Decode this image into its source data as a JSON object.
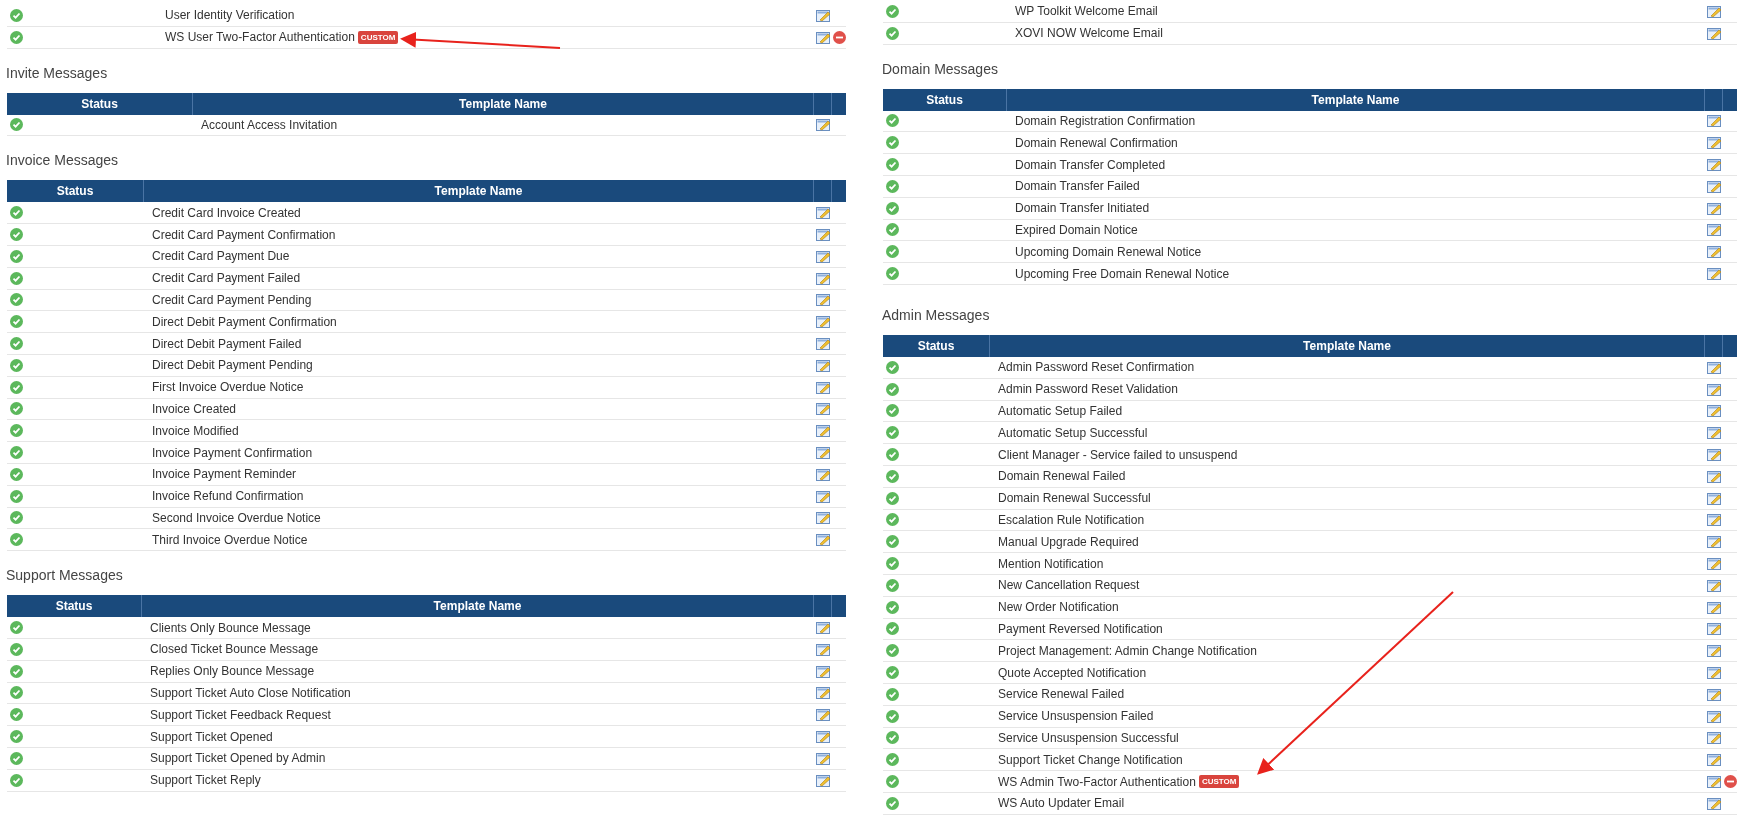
{
  "columns": [
    {
      "sections": [
        {
          "rows": [
            {
              "status": true,
              "name": "User Identity Verification",
              "edit": true,
              "delete": false
            },
            {
              "status": true,
              "name": "WS User Two-Factor Authentication",
              "badge": "CUSTOM",
              "edit": true,
              "delete": true
            }
          ]
        },
        {
          "title": "Invite Messages",
          "headers": [
            "Status",
            "Template Name"
          ],
          "rows": [
            {
              "status": true,
              "name": "Account Access Invitation",
              "edit": true,
              "delete": false
            }
          ]
        },
        {
          "title": "Invoice Messages",
          "headers": [
            "Status",
            "Template Name"
          ],
          "rows": [
            {
              "status": true,
              "name": "Credit Card Invoice Created",
              "edit": true,
              "delete": false
            },
            {
              "status": true,
              "name": "Credit Card Payment Confirmation",
              "edit": true,
              "delete": false
            },
            {
              "status": true,
              "name": "Credit Card Payment Due",
              "edit": true,
              "delete": false
            },
            {
              "status": true,
              "name": "Credit Card Payment Failed",
              "edit": true,
              "delete": false
            },
            {
              "status": true,
              "name": "Credit Card Payment Pending",
              "edit": true,
              "delete": false
            },
            {
              "status": true,
              "name": "Direct Debit Payment Confirmation",
              "edit": true,
              "delete": false
            },
            {
              "status": true,
              "name": "Direct Debit Payment Failed",
              "edit": true,
              "delete": false
            },
            {
              "status": true,
              "name": "Direct Debit Payment Pending",
              "edit": true,
              "delete": false
            },
            {
              "status": true,
              "name": "First Invoice Overdue Notice",
              "edit": true,
              "delete": false
            },
            {
              "status": true,
              "name": "Invoice Created",
              "edit": true,
              "delete": false
            },
            {
              "status": true,
              "name": "Invoice Modified",
              "edit": true,
              "delete": false
            },
            {
              "status": true,
              "name": "Invoice Payment Confirmation",
              "edit": true,
              "delete": false
            },
            {
              "status": true,
              "name": "Invoice Payment Reminder",
              "edit": true,
              "delete": false
            },
            {
              "status": true,
              "name": "Invoice Refund Confirmation",
              "edit": true,
              "delete": false
            },
            {
              "status": true,
              "name": "Second Invoice Overdue Notice",
              "edit": true,
              "delete": false
            },
            {
              "status": true,
              "name": "Third Invoice Overdue Notice",
              "edit": true,
              "delete": false
            }
          ]
        },
        {
          "title": "Support Messages",
          "headers": [
            "Status",
            "Template Name"
          ],
          "rows": [
            {
              "status": true,
              "name": "Clients Only Bounce Message",
              "edit": true,
              "delete": false
            },
            {
              "status": true,
              "name": "Closed Ticket Bounce Message",
              "edit": true,
              "delete": false
            },
            {
              "status": true,
              "name": "Replies Only Bounce Message",
              "edit": true,
              "delete": false
            },
            {
              "status": true,
              "name": "Support Ticket Auto Close Notification",
              "edit": true,
              "delete": false
            },
            {
              "status": true,
              "name": "Support Ticket Feedback Request",
              "edit": true,
              "delete": false
            },
            {
              "status": true,
              "name": "Support Ticket Opened",
              "edit": true,
              "delete": false
            },
            {
              "status": true,
              "name": "Support Ticket Opened by Admin",
              "edit": true,
              "delete": false
            },
            {
              "status": true,
              "name": "Support Ticket Reply",
              "edit": true,
              "delete": false
            }
          ]
        }
      ]
    },
    {
      "sections": [
        {
          "rows": [
            {
              "status": true,
              "name": "WP Toolkit Welcome Email",
              "edit": true,
              "delete": false
            },
            {
              "status": true,
              "name": "XOVI NOW Welcome Email",
              "edit": true,
              "delete": false
            }
          ]
        },
        {
          "title": "Domain Messages",
          "headers": [
            "Status",
            "Template Name"
          ],
          "rows": [
            {
              "status": true,
              "name": "Domain Registration Confirmation",
              "edit": true,
              "delete": false
            },
            {
              "status": true,
              "name": "Domain Renewal Confirmation",
              "edit": true,
              "delete": false
            },
            {
              "status": true,
              "name": "Domain Transfer Completed",
              "edit": true,
              "delete": false
            },
            {
              "status": true,
              "name": "Domain Transfer Failed",
              "edit": true,
              "delete": false
            },
            {
              "status": true,
              "name": "Domain Transfer Initiated",
              "edit": true,
              "delete": false
            },
            {
              "status": true,
              "name": "Expired Domain Notice",
              "edit": true,
              "delete": false
            },
            {
              "status": true,
              "name": "Upcoming Domain Renewal Notice",
              "edit": true,
              "delete": false
            },
            {
              "status": true,
              "name": "Upcoming Free Domain Renewal Notice",
              "edit": true,
              "delete": false
            }
          ]
        },
        {
          "title": "Admin Messages",
          "headers": [
            "Status",
            "Template Name"
          ],
          "rows": [
            {
              "status": true,
              "name": "Admin Password Reset Confirmation",
              "edit": true,
              "delete": false
            },
            {
              "status": true,
              "name": "Admin Password Reset Validation",
              "edit": true,
              "delete": false
            },
            {
              "status": true,
              "name": "Automatic Setup Failed",
              "edit": true,
              "delete": false
            },
            {
              "status": true,
              "name": "Automatic Setup Successful",
              "edit": true,
              "delete": false
            },
            {
              "status": true,
              "name": "Client Manager - Service failed to unsuspend",
              "edit": true,
              "delete": false
            },
            {
              "status": true,
              "name": "Domain Renewal Failed",
              "edit": true,
              "delete": false
            },
            {
              "status": true,
              "name": "Domain Renewal Successful",
              "edit": true,
              "delete": false
            },
            {
              "status": true,
              "name": "Escalation Rule Notification",
              "edit": true,
              "delete": false
            },
            {
              "status": true,
              "name": "Manual Upgrade Required",
              "edit": true,
              "delete": false
            },
            {
              "status": true,
              "name": "Mention Notification",
              "edit": true,
              "delete": false
            },
            {
              "status": true,
              "name": "New Cancellation Request",
              "edit": true,
              "delete": false
            },
            {
              "status": true,
              "name": "New Order Notification",
              "edit": true,
              "delete": false
            },
            {
              "status": true,
              "name": "Payment Reversed Notification",
              "edit": true,
              "delete": false
            },
            {
              "status": true,
              "name": "Project Management: Admin Change Notification",
              "edit": true,
              "delete": false
            },
            {
              "status": true,
              "name": "Quote Accepted Notification",
              "edit": true,
              "delete": false
            },
            {
              "status": true,
              "name": "Service Renewal Failed",
              "edit": true,
              "delete": false
            },
            {
              "status": true,
              "name": "Service Unsuspension Failed",
              "edit": true,
              "delete": false
            },
            {
              "status": true,
              "name": "Service Unsuspension Successful",
              "edit": true,
              "delete": false
            },
            {
              "status": true,
              "name": "Support Ticket Change Notification",
              "edit": true,
              "delete": false
            },
            {
              "status": true,
              "name": "WS Admin Two-Factor Authentication",
              "badge": "CUSTOM",
              "edit": true,
              "delete": true
            },
            {
              "status": true,
              "name": "WS Auto Updater Email",
              "edit": true,
              "delete": false
            }
          ]
        }
      ]
    }
  ]
}
